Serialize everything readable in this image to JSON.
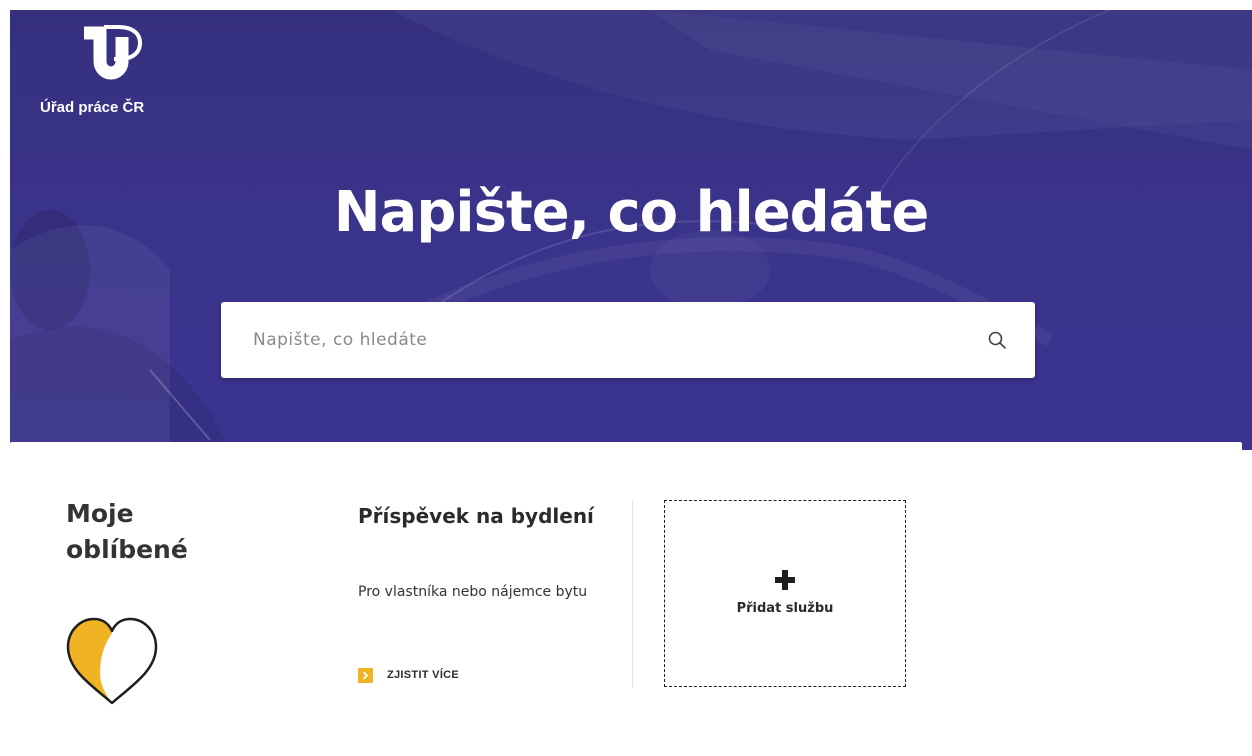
{
  "brand": {
    "logo_text": "Úřad práce ČR"
  },
  "hero": {
    "title": "Napište, co hledáte",
    "background_color": "#3a338a"
  },
  "search": {
    "placeholder": "Napište, co hledáte",
    "icon": "search-icon"
  },
  "favorites": {
    "title_line1": "Moje",
    "title_line2": "oblíbené",
    "icon": "heart-icon",
    "accent_color": "#f0b323"
  },
  "service_card": {
    "title": "Příspěvek na bydlení",
    "description": "Pro vlastníka nebo nájemce bytu",
    "link_label": "ZJISTIT VÍCE",
    "link_icon": "chevron-right-icon"
  },
  "add_service": {
    "label": "Přidat službu",
    "icon": "plus-icon"
  }
}
